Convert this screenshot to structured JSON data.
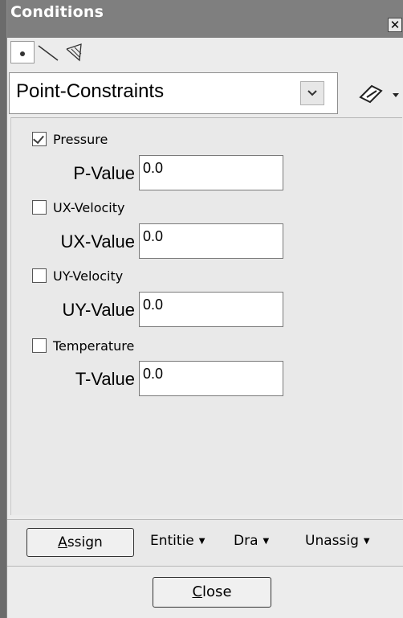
{
  "window": {
    "title": "Conditions",
    "close_glyph": "✕"
  },
  "toolbar": {
    "icons": [
      "point-icon",
      "line-icon",
      "surface-icon"
    ]
  },
  "condition_select": {
    "selected": "Point-Constraints"
  },
  "fields": [
    {
      "checkbox_label": "Pressure",
      "checked": true,
      "value_label": "P-Value",
      "value": "0.0"
    },
    {
      "checkbox_label": "UX-Velocity",
      "checked": false,
      "value_label": "UX-Value",
      "value": "0.0"
    },
    {
      "checkbox_label": "UY-Velocity",
      "checked": false,
      "value_label": "UY-Value",
      "value": "0.0"
    },
    {
      "checkbox_label": "Temperature",
      "checked": false,
      "value_label": "T-Value",
      "value": "0.0"
    }
  ],
  "actions": {
    "assign": "Assign",
    "entities": "Entitie",
    "draw": "Dra",
    "unassign": "Unassig",
    "caret": "▼"
  },
  "footer": {
    "close": "Close"
  },
  "colors": {
    "titlebar": "#7f7f7f",
    "panel": "#e9e9e9",
    "background": "#6b6b6b"
  }
}
